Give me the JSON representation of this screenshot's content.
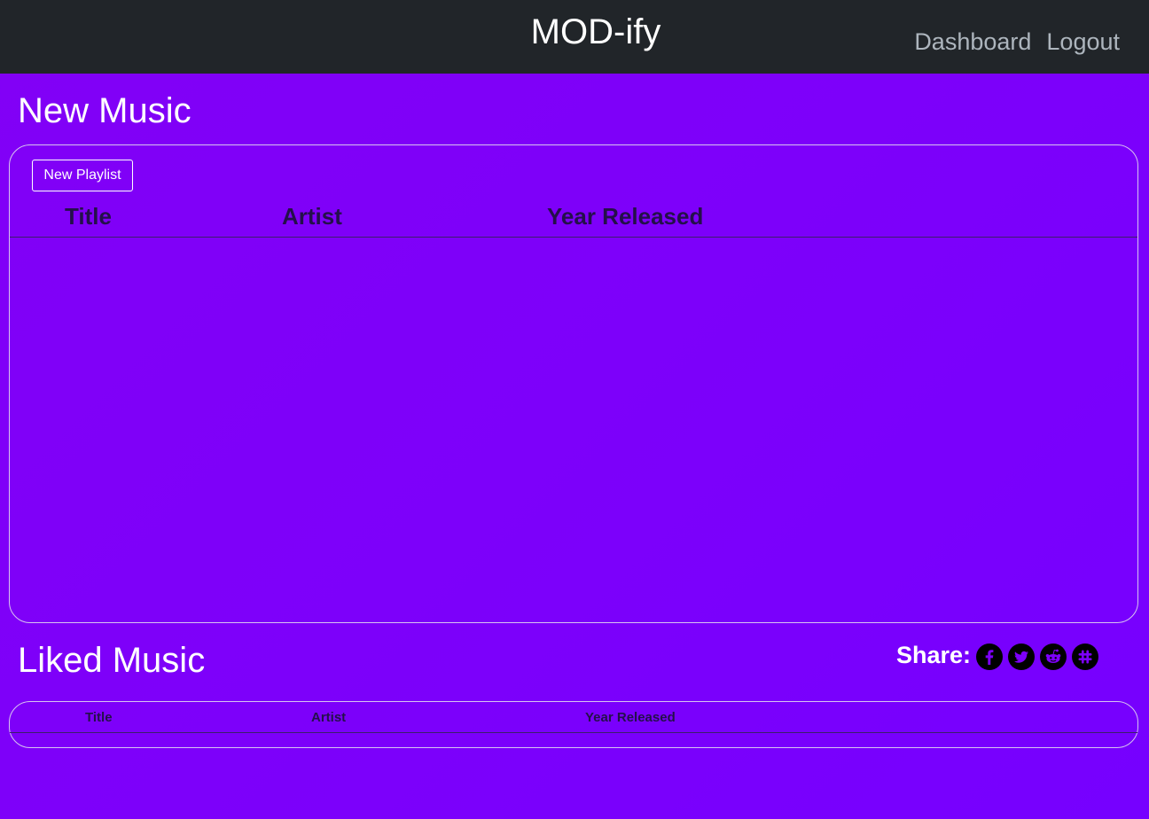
{
  "header": {
    "brand": "MOD-ify",
    "nav": [
      "Dashboard",
      "Logout"
    ]
  },
  "new_music": {
    "heading": "New Music",
    "new_playlist_button": "New Playlist",
    "columns": [
      "Title",
      "Artist",
      "Year Released"
    ],
    "rows": []
  },
  "liked_music": {
    "heading": "Liked Music",
    "columns": [
      "Title",
      "Artist",
      "Year Released"
    ],
    "rows": []
  },
  "share": {
    "label": "Share:",
    "icons": [
      "facebook-icon",
      "twitter-icon",
      "reddit-icon",
      "slack-icon"
    ]
  },
  "colors": {
    "background": "#7d00fa",
    "navbar": "#212529",
    "nav_link": "#adb5bd",
    "header_text": "#24104a"
  }
}
